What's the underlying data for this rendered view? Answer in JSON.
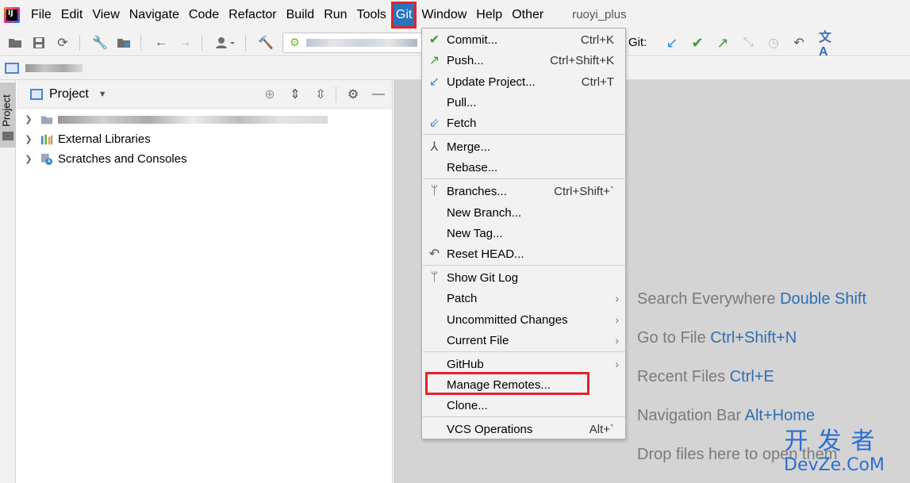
{
  "menubar": {
    "items": [
      "File",
      "Edit",
      "View",
      "Navigate",
      "Code",
      "Refactor",
      "Build",
      "Run",
      "Tools",
      "Git",
      "Window",
      "Help",
      "Other"
    ],
    "project_title": "ruoyi_plus"
  },
  "toolbar": {
    "git_label": "Git:"
  },
  "side_strip": {
    "tab_label": "Project"
  },
  "project_panel": {
    "title": "Project",
    "tree": [
      {
        "label": "",
        "blurred": true
      },
      {
        "label": "External Libraries"
      },
      {
        "label": "Scratches and Consoles"
      }
    ]
  },
  "git_menu": {
    "items": [
      {
        "label": "Commit...",
        "shortcut": "Ctrl+K",
        "icon": "check-icon"
      },
      {
        "label": "Push...",
        "shortcut": "Ctrl+Shift+K",
        "icon": "push-arrow-icon"
      },
      {
        "label": "Update Project...",
        "shortcut": "Ctrl+T",
        "icon": "update-arrow-icon"
      },
      {
        "label": "Pull...",
        "shortcut": "",
        "icon": ""
      },
      {
        "label": "Fetch",
        "shortcut": "",
        "icon": "fetch-icon"
      },
      {
        "label": "Merge...",
        "shortcut": "",
        "icon": "merge-icon"
      },
      {
        "label": "Rebase...",
        "shortcut": "",
        "icon": ""
      },
      {
        "label": "Branches...",
        "shortcut": "Ctrl+Shift+`",
        "icon": "branch-icon"
      },
      {
        "label": "New Branch...",
        "shortcut": "",
        "icon": ""
      },
      {
        "label": "New Tag...",
        "shortcut": "",
        "icon": ""
      },
      {
        "label": "Reset HEAD...",
        "shortcut": "",
        "icon": "reset-icon"
      },
      {
        "label": "Show Git Log",
        "shortcut": "",
        "icon": "git-log-icon"
      },
      {
        "label": "Patch",
        "shortcut": "",
        "icon": "",
        "submenu": true
      },
      {
        "label": "Uncommitted Changes",
        "shortcut": "",
        "icon": "",
        "submenu": true
      },
      {
        "label": "Current File",
        "shortcut": "",
        "icon": "",
        "submenu": true
      },
      {
        "label": "GitHub",
        "shortcut": "",
        "icon": "",
        "submenu": true
      },
      {
        "label": "Manage Remotes...",
        "shortcut": "",
        "icon": ""
      },
      {
        "label": "Clone...",
        "shortcut": "",
        "icon": ""
      },
      {
        "label": "VCS Operations",
        "shortcut": "Alt+`",
        "icon": ""
      }
    ]
  },
  "editor_hints": [
    {
      "text": "Search Everywhere",
      "key": "Double Shift"
    },
    {
      "text": "Go to File",
      "key": "Ctrl+Shift+N"
    },
    {
      "text": "Recent Files",
      "key": "Ctrl+E"
    },
    {
      "text": "Navigation Bar",
      "key": "Alt+Home"
    },
    {
      "text": "Drop files here to open them",
      "key": ""
    }
  ],
  "watermark": {
    "top": "开发者",
    "bottom": "DevZe.CoM"
  },
  "colors": {
    "git_menu_highlight": "#2675bf",
    "annotation_red": "#e0242b",
    "hint_key": "#2f6fb3",
    "editor_bg": "#d4d4d4"
  }
}
